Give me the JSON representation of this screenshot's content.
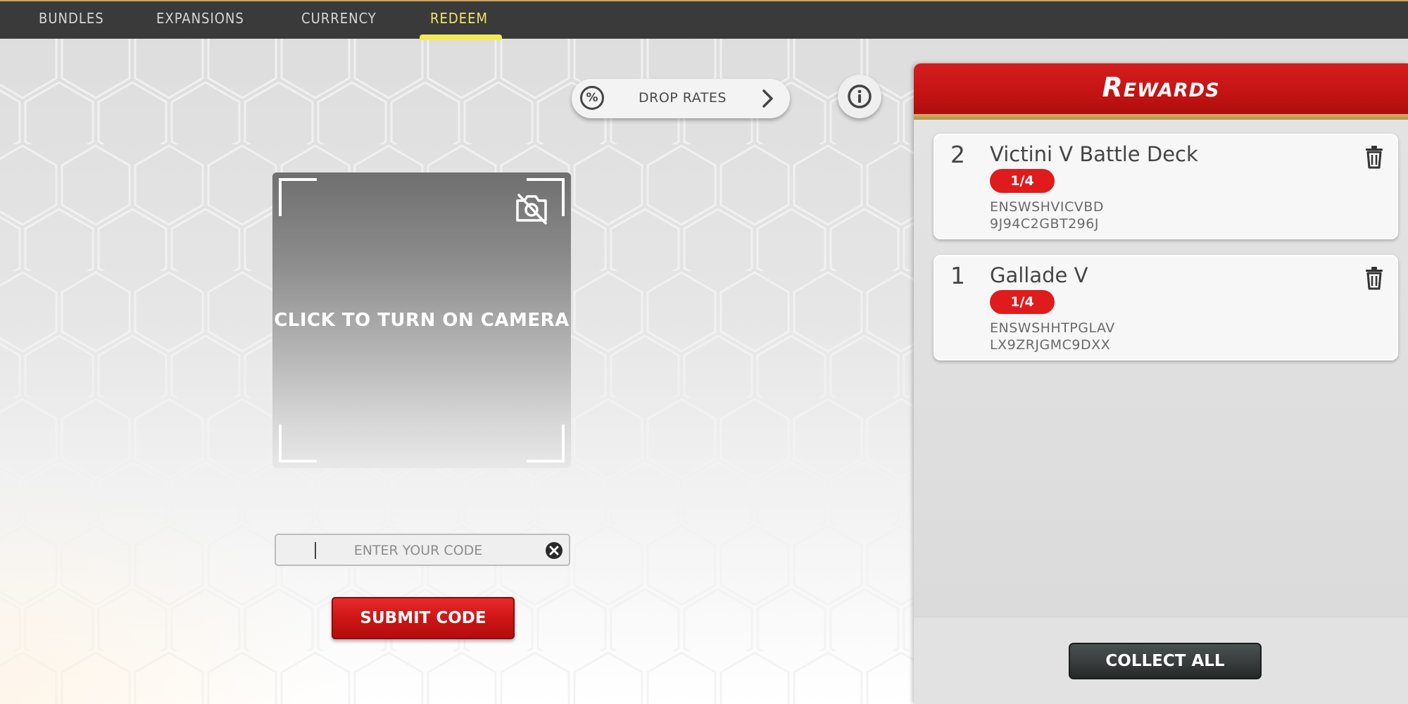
{
  "nav": {
    "tabs": [
      {
        "label": "BUNDLES",
        "active": false
      },
      {
        "label": "EXPANSIONS",
        "active": false
      },
      {
        "label": "CURRENCY",
        "active": false
      },
      {
        "label": "REDEEM",
        "active": true
      }
    ],
    "active_color": "#f3ea59"
  },
  "drop_rates": {
    "label": "DROP RATES",
    "icon": "percent-icon",
    "symbol": "%"
  },
  "camera": {
    "label": "CLICK TO TURN ON CAMERA",
    "icon": "camera-off-icon"
  },
  "code_entry": {
    "placeholder": "ENTER YOUR CODE",
    "value": ""
  },
  "submit": {
    "label": "SUBMIT CODE"
  },
  "rewards": {
    "title": "Rewards",
    "items": [
      {
        "quantity": "2",
        "name": "Victini V Battle Deck",
        "badge": "1/4",
        "code_line1": "ENSWSHVICVBD",
        "code_line2": "9J94C2GBT296J"
      },
      {
        "quantity": "1",
        "name": "Gallade V",
        "badge": "1/4",
        "code_line1": "ENSWSHHTPGLAV",
        "code_line2": "LX9ZRJGMC9DXX"
      }
    ],
    "collect_label": "COLLECT ALL"
  },
  "colors": {
    "nav_bg": "#3a3a3a",
    "header_red": "#c41313",
    "submit_red": "#cc1414",
    "badge_red": "#e01b1b",
    "collect_dark": "#3a3e3e"
  }
}
